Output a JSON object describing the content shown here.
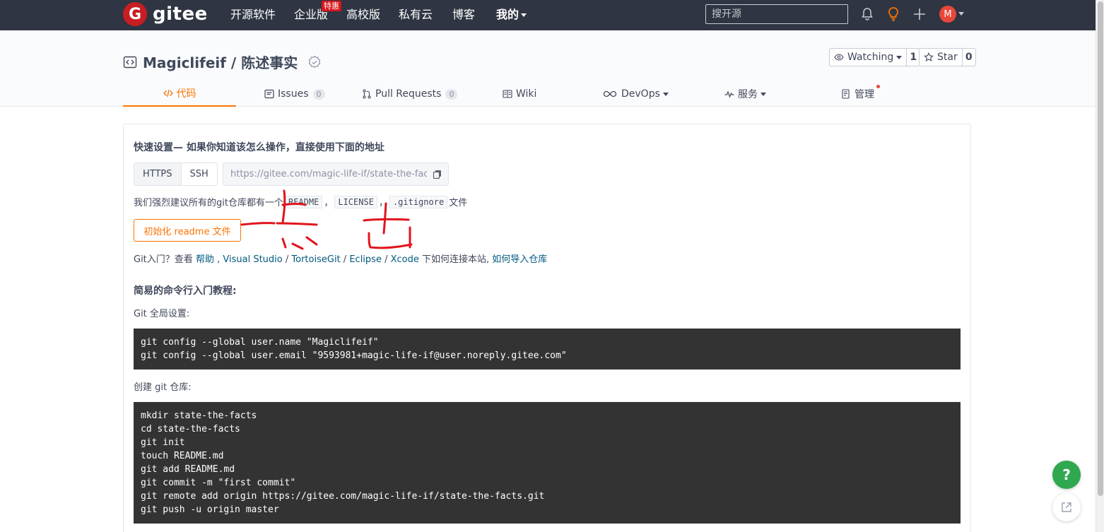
{
  "nav": {
    "logo_mark": "G",
    "logo_text": "gitee",
    "items": [
      {
        "label": "开源软件"
      },
      {
        "label": "企业版"
      },
      {
        "label": "高校版"
      },
      {
        "label": "私有云"
      },
      {
        "label": "博客"
      },
      {
        "label": "我的"
      }
    ],
    "enterprise_badge": "特惠",
    "search_placeholder": "搜开源",
    "avatar_letter": "M",
    "icons": [
      "bell-icon",
      "lightbulb-icon",
      "plus-icon"
    ]
  },
  "repo": {
    "title": "Magiclifeif / 陈述事实",
    "watching_label": "Watching",
    "watching_count": "1",
    "star_label": "Star",
    "star_count": "0"
  },
  "tabs": [
    {
      "label": "代码",
      "icon": "code-icon",
      "active": true
    },
    {
      "label": "Issues",
      "count": "0",
      "icon": "issues-icon"
    },
    {
      "label": "Pull Requests",
      "count": "0",
      "icon": "pull-request-icon"
    },
    {
      "label": "Wiki",
      "icon": "wiki-icon"
    },
    {
      "label": "DevOps",
      "icon": "devops-icon"
    },
    {
      "label": "服务",
      "icon": "pulse-icon"
    },
    {
      "label": "管理",
      "icon": "manage-icon"
    }
  ],
  "quick": {
    "title": "快速设置— 如果你知道该怎么操作，直接使用下面的地址",
    "https_label": "HTTPS",
    "ssh_label": "SSH",
    "url": "https://gitee.com/magic-life-if/state-the-facts.git",
    "recommend_prefix": "我们强烈建议所有的git仓库都有一个",
    "readme": "README",
    "sep1": "，",
    "license": "LICENSE",
    "sep2": "，",
    "gitignore": ".gitignore",
    "recommend_suffix": "文件",
    "init_button": "初始化 readme 文件",
    "intro_prefix": "Git入门？查看",
    "link_help": "帮助",
    "sep_a": ",",
    "link_vs": "Visual Studio",
    "sep_b": "/",
    "link_tortoise": "TortoiseGit",
    "sep_c": "/",
    "link_eclipse": "Eclipse",
    "sep_d": "/",
    "link_xcode": "Xcode",
    "intro_mid": "下如何连接本站,",
    "link_import": "如何导入仓库"
  },
  "tutorial": {
    "heading": "简易的命令行入门教程:",
    "global_label": "Git 全局设置:",
    "global_code": "git config --global user.name \"Magiclifeif\"\ngit config --global user.email \"9593981+magic-life-if@user.noreply.gitee.com\"",
    "create_label": "创建 git 仓库:",
    "create_code": "mkdir state-the-facts\ncd state-the-facts\ngit init\ntouch README.md\ngit add README.md\ngit commit -m \"first commit\"\ngit remote add origin https://gitee.com/magic-life-if/state-the-facts.git\ngit push -u origin master"
  },
  "floating": {
    "help_label": "?"
  },
  "colors": {
    "nav_bg": "#2f3542",
    "accent": "#fe7300",
    "brand_red": "#c71d23",
    "link": "#005980",
    "code_bg": "#333333",
    "help_green": "#2fa84f",
    "annotation_red": "#e0141e"
  }
}
